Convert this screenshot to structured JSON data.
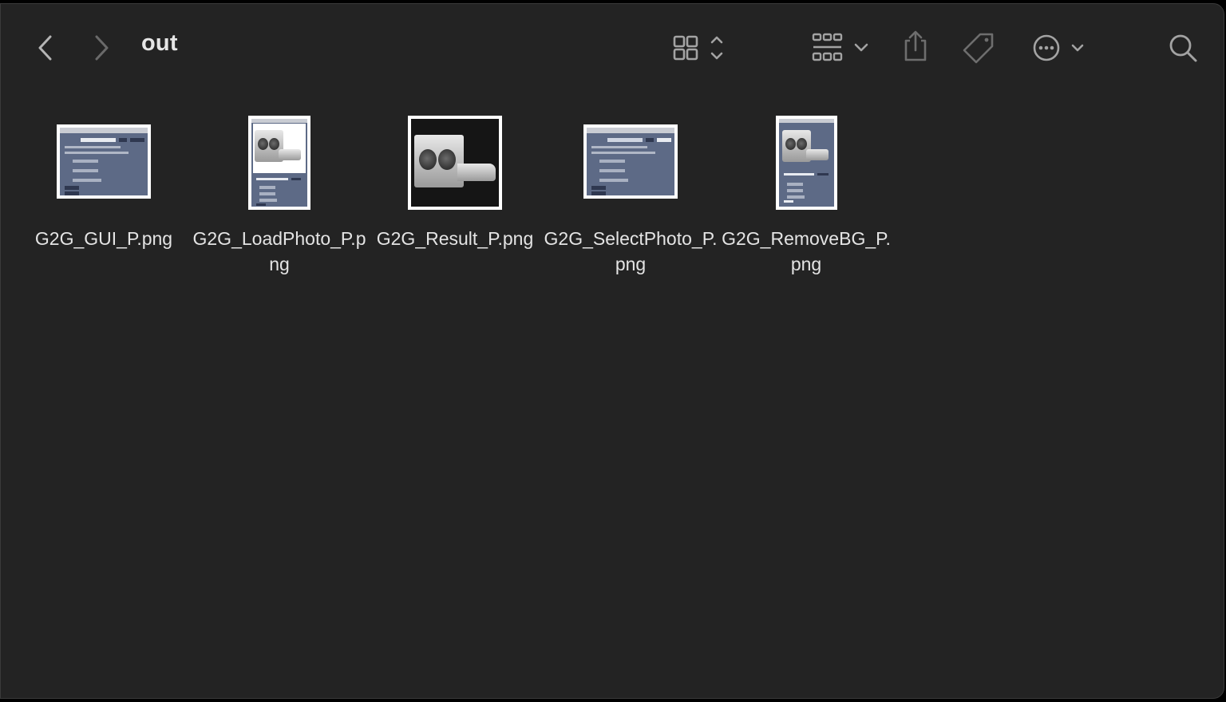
{
  "window": {
    "title": "out"
  },
  "toolbar": {
    "back_icon": "chevron-left-icon",
    "forward_icon": "chevron-right-icon",
    "view_icon": "icon-grid-view-icon",
    "group_icon": "group-by-icon",
    "share_icon": "share-icon",
    "tag_icon": "tag-icon",
    "more_icon": "more-actions-icon",
    "search_icon": "search-icon"
  },
  "files": [
    {
      "name": "G2G_GUI_P.png"
    },
    {
      "name": "G2G_LoadPhoto_P.png"
    },
    {
      "name": "G2G_Result_P.png"
    },
    {
      "name": "G2G_SelectPhoto_P.png"
    },
    {
      "name": "G2G_RemoveBG_P.png"
    }
  ],
  "colors": {
    "window_bg": "#232323",
    "text": "#e4e4e4",
    "icon": "#9a9a9a"
  }
}
